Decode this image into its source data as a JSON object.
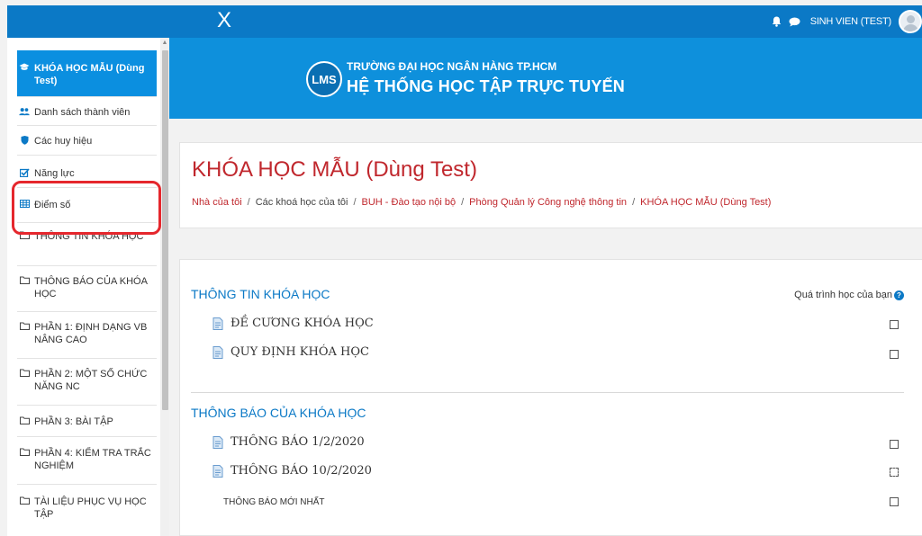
{
  "topbar": {
    "close_glyph": "X",
    "user_name": "SINH VIEN (TEST)",
    "icons": [
      "bell-icon",
      "chat-icon",
      "avatar"
    ]
  },
  "sidebar": {
    "items": [
      {
        "label": "KHÓA HỌC MẪU (Dùng Test)",
        "icon": "graduation-cap-icon"
      },
      {
        "label": "Danh sách thành viên",
        "icon": "users-icon"
      },
      {
        "label": "Các huy hiệu",
        "icon": "shield-icon"
      },
      {
        "label": "Năng lực",
        "icon": "checkbox-icon"
      },
      {
        "label": "Điểm số",
        "icon": "table-icon"
      },
      {
        "label": "THÔNG TIN KHÓA HỌC",
        "icon": "folder-icon"
      },
      {
        "label": "THÔNG BÁO CỦA KHÓA HỌC",
        "icon": "folder-icon"
      },
      {
        "label": "PHẦN 1: ĐỊNH DẠNG VB NÂNG CAO",
        "icon": "folder-icon"
      },
      {
        "label": "PHẦN 2: MỘT SỐ CHỨC NĂNG NC",
        "icon": "folder-icon"
      },
      {
        "label": "PHẦN 3: BÀI TẬP",
        "icon": "folder-icon"
      },
      {
        "label": "PHẦN 4: KIỂM TRA TRẮC NGHIỆM",
        "icon": "folder-icon"
      },
      {
        "label": "TÀI LIỆU PHỤC VỤ HỌC TẬP",
        "icon": "folder-icon"
      }
    ]
  },
  "banner": {
    "logo_text": "LMS",
    "line1": "TRƯỜNG ĐẠI HỌC NGÂN HÀNG TP.HCM",
    "line2": "HỆ THỐNG HỌC TẬP TRỰC TUYẾN"
  },
  "main": {
    "title": "KHÓA HỌC MẪU (Dùng Test)",
    "breadcrumb": [
      "Nhà của tôi",
      "Các khoá học của tôi",
      "BUH - Đào tạo nội bộ",
      "Phòng Quản lý Công nghệ thông tin",
      "KHÓA HỌC MẪU (Dùng Test)"
    ],
    "breadcrumb_sep": "/",
    "progress_label": "Quá trình học của bạn",
    "help_glyph": "?",
    "sections": [
      {
        "title": "THÔNG TIN KHÓA HỌC",
        "items": [
          "ĐỀ CƯƠNG KHÓA HỌC",
          "QUY ĐỊNH KHÓA HỌC"
        ]
      },
      {
        "title": "THÔNG BÁO CỦA KHÓA HỌC",
        "items": [
          "THÔNG BÁO 1/2/2020",
          "THÔNG BÁO 10/2/2020"
        ],
        "note": "THÔNG BÁO MỚI NHẤT"
      }
    ]
  },
  "colors": {
    "topbar": "#0b79c6",
    "banner": "#0e90dc",
    "active_item": "#0b8fe0",
    "title_red": "#c0272d",
    "highlight_red": "#e5272d",
    "link_blue": "#0b79c6"
  }
}
